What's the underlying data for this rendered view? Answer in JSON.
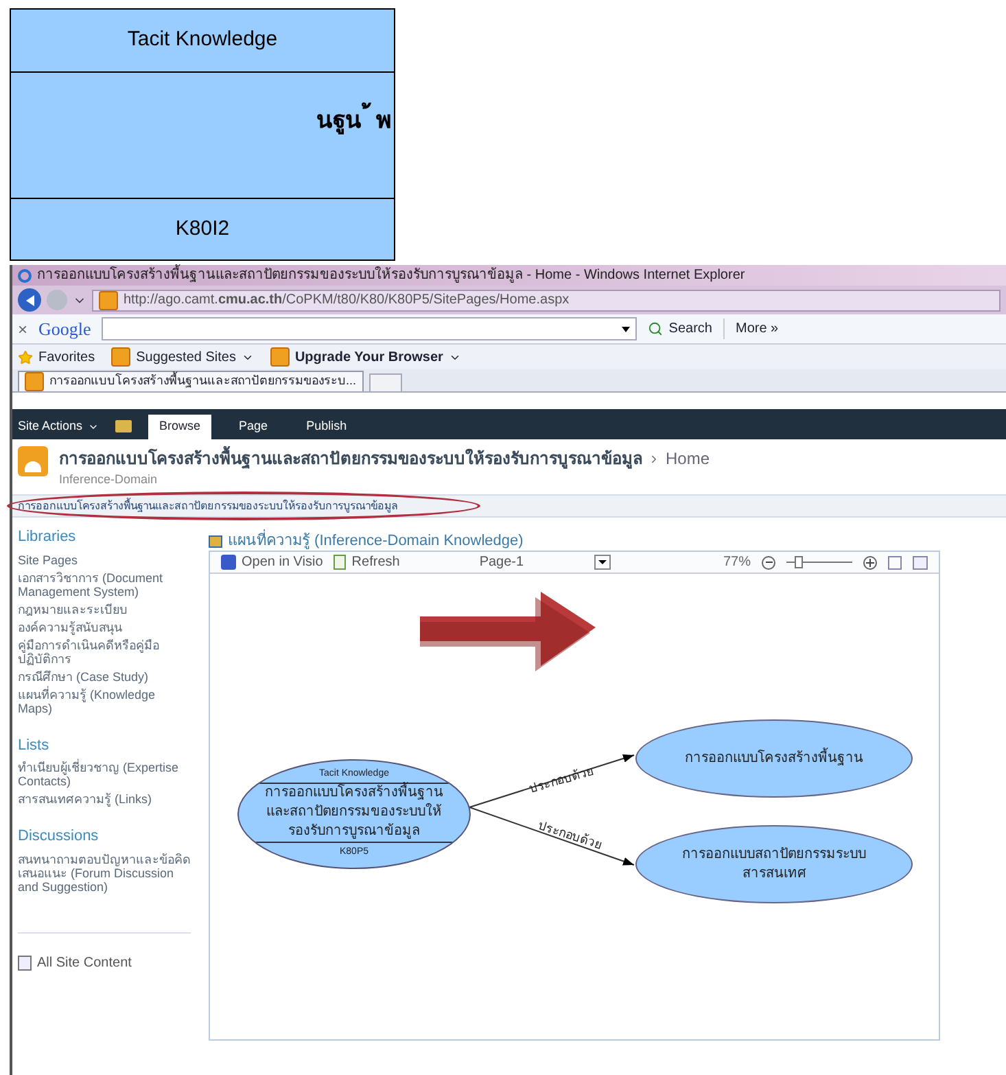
{
  "diagram_excerpt": {
    "header": "Tacit Knowledge",
    "body": "นฐูน ้ พ",
    "footer": "K80I2"
  },
  "browser": {
    "title": "การออกแบบโครงสร้างพื้นฐานและสถาปัตยกรรมของระบบให้รองรับการบูรณาข้อมูล - Home - Windows Internet Explorer",
    "address": "http://ago.camt.**cmu.ac.th**/CoPKM/t80/K80/K80P5/SitePages/Home.aspx",
    "close_mark": "×",
    "google_logo": "Google",
    "search_button": "Search",
    "more_button": "More »",
    "favorites": [
      {
        "label": "Favorites",
        "kind": "star"
      },
      {
        "label": "Suggested Sites",
        "kind": "menu"
      },
      {
        "label": "Upgrade Your Browser",
        "kind": "menu"
      }
    ],
    "tab": "การออกแบบโครงสร้างพื้นฐานและสถาปัตยกรรมของระบ..."
  },
  "ribbon": {
    "site_actions": "Site Actions",
    "tabs": [
      {
        "label": "Browse",
        "selected": true
      },
      {
        "label": "Page",
        "selected": false
      },
      {
        "label": "Publish",
        "selected": false
      }
    ]
  },
  "site": {
    "title": "การออกแบบโครงสร้างพื้นฐานและสถาปัตยกรรมของระบบให้รองรับการบูรณาข้อมูล",
    "current": "Home",
    "subtitle": "Inference-Domain",
    "breadcrumb": "การออกแบบโครงสร้างพื้นฐานและสถาปัตยกรรมของระบบให้รองรับการบูรณาข้อมูล"
  },
  "sidebar": {
    "sections": [
      {
        "heading": "Libraries",
        "items": [
          "Site Pages",
          "เอกสารวิชาการ (Document Management System)",
          "กฎหมายและระเบียบ",
          "องค์ความรู้สนับสนุน",
          "คู่มือการดำเนินคดีหรือคู่มือปฏิบัติการ",
          "กรณีศึกษา (Case Study)",
          "แผนที่ความรู้ (Knowledge Maps)"
        ]
      },
      {
        "heading": "Lists",
        "items": [
          "ทำเนียบผู้เชี่ยวชาญ (Expertise Contacts)",
          "สารสนเทศความรู้ (Links)"
        ]
      },
      {
        "heading": "Discussions",
        "items": [
          "สนทนาถามตอบปัญหาและข้อคิดเสนอแนะ (Forum Discussion and Suggestion)"
        ]
      }
    ],
    "all_content": "All Site Content"
  },
  "web_part": {
    "title": "แผนที่ความรู้ (Inference-Domain Knowledge)",
    "open_in_visio": "Open in Visio",
    "refresh": "Refresh",
    "page": "Page-1",
    "zoom": "77%",
    "zoom_slider": {
      "level": 0.15
    },
    "diagram": {
      "source": {
        "header": "Tacit Knowledge",
        "body": "การออกแบบโครงสร้างพื้นฐานและสถาปัตยกรรมของระบบให้รองรับการบูรณาข้อมูล",
        "footer": "K80P5"
      },
      "targets": [
        {
          "label": "การออกแบบโครงสร้างพื้นฐาน",
          "edge_label": "ประกอบด้วย"
        },
        {
          "label": "การออกแบบสถาปัตยกรรมระบบสารสนเทศ",
          "edge_label": "ประกอบด้วย"
        }
      ]
    }
  }
}
